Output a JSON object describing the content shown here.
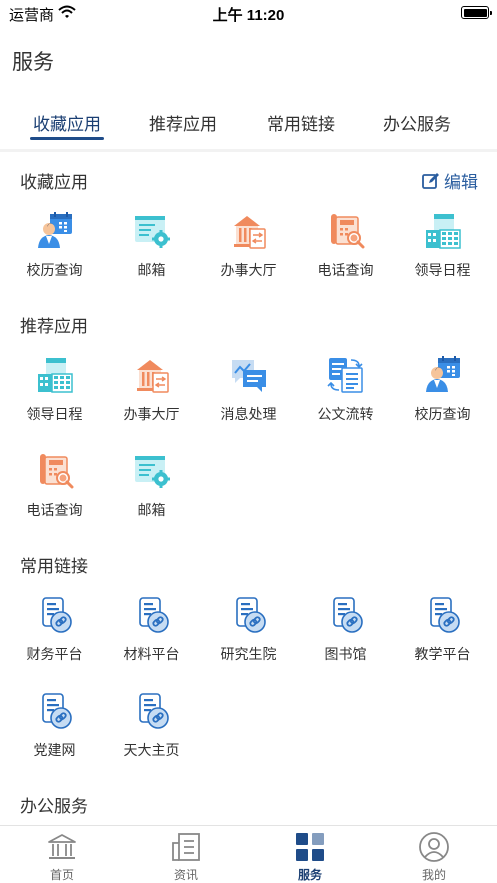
{
  "status_bar": {
    "carrier": "运营商",
    "time": "上午 11:20"
  },
  "page_title": "服务",
  "tabs": [
    {
      "label": "收藏应用",
      "active": true
    },
    {
      "label": "推荐应用",
      "active": false
    },
    {
      "label": "常用链接",
      "active": false
    },
    {
      "label": "办公服务",
      "active": false
    }
  ],
  "favorites": {
    "title": "收藏应用",
    "edit_label": "编辑",
    "items": [
      {
        "label": "校历查询",
        "icon": "calendar-person-icon"
      },
      {
        "label": "邮箱",
        "icon": "mailbox-gear-icon"
      },
      {
        "label": "办事大厅",
        "icon": "service-hall-icon"
      },
      {
        "label": "电话查询",
        "icon": "telephone-search-icon"
      },
      {
        "label": "领导日程",
        "icon": "leader-schedule-icon"
      }
    ]
  },
  "recommended": {
    "title": "推荐应用",
    "items": [
      {
        "label": "领导日程",
        "icon": "leader-schedule-icon"
      },
      {
        "label": "办事大厅",
        "icon": "service-hall-icon"
      },
      {
        "label": "消息处理",
        "icon": "message-chart-icon"
      },
      {
        "label": "公文流转",
        "icon": "document-flow-icon"
      },
      {
        "label": "校历查询",
        "icon": "calendar-person-icon"
      },
      {
        "label": "电话查询",
        "icon": "telephone-search-icon"
      },
      {
        "label": "邮箱",
        "icon": "mailbox-gear-icon"
      }
    ]
  },
  "links": {
    "title": "常用链接",
    "items": [
      {
        "label": "财务平台",
        "icon": "link-document-icon"
      },
      {
        "label": "材料平台",
        "icon": "link-document-icon"
      },
      {
        "label": "研究生院",
        "icon": "link-document-icon"
      },
      {
        "label": "图书馆",
        "icon": "link-document-icon"
      },
      {
        "label": "教学平台",
        "icon": "link-document-icon"
      },
      {
        "label": "党建网",
        "icon": "link-document-icon"
      },
      {
        "label": "天大主页",
        "icon": "link-document-icon"
      }
    ]
  },
  "office": {
    "title": "办公服务"
  },
  "tabbar": [
    {
      "label": "首页",
      "icon": "bank-icon",
      "active": false
    },
    {
      "label": "资讯",
      "icon": "news-icon",
      "active": false
    },
    {
      "label": "服务",
      "icon": "grid-icon",
      "active": true
    },
    {
      "label": "我的",
      "icon": "user-icon",
      "active": false
    }
  ],
  "colors": {
    "accent": "#1f4c89",
    "blue_icon": "#3a8ee6",
    "orange_icon": "#f08a5d",
    "teal_icon": "#3cc0cf"
  }
}
